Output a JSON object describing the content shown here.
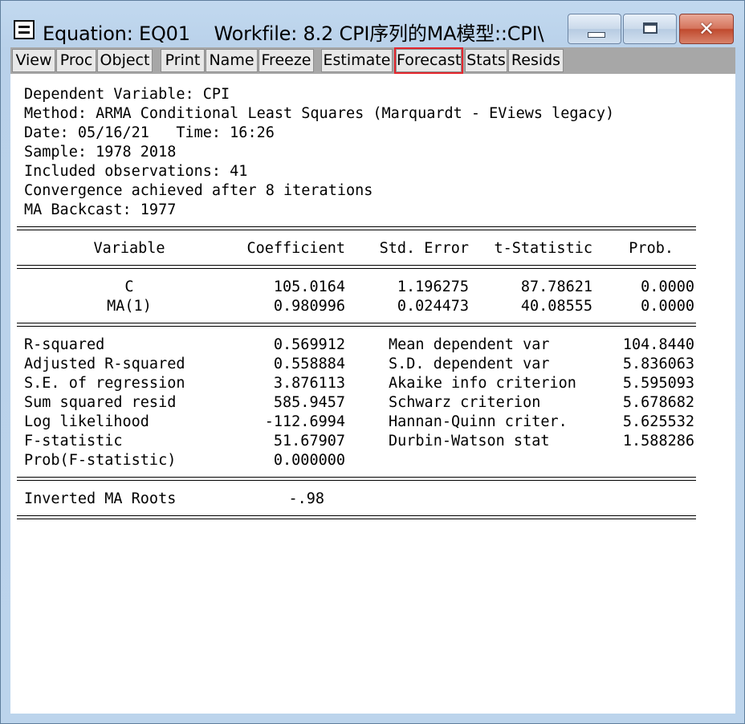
{
  "window": {
    "title": "Equation: EQ01    Workfile: 8.2 CPI序列的MA模型::CPI\\",
    "close_label": "✕"
  },
  "toolbar": {
    "buttons": [
      "View",
      "Proc",
      "Object",
      "Print",
      "Name",
      "Freeze",
      "Estimate",
      "Forecast",
      "Stats",
      "Resids"
    ],
    "highlighted": "Forecast",
    "highlight_color": "#e4262d"
  },
  "header": {
    "dependent": "Dependent Variable: CPI",
    "method": "Method: ARMA Conditional Least Squares (Marquardt - EViews legacy)",
    "date": "Date: 05/16/21   Time: 16:26",
    "sample": "Sample: 1978 2018",
    "observations": "Included observations: 41",
    "convergence": "Convergence achieved after 8 iterations",
    "backcast": "MA Backcast: 1977"
  },
  "coef_table": {
    "headers": [
      "Variable",
      "Coefficient",
      "Std. Error",
      "t-Statistic",
      "Prob."
    ],
    "rows": [
      [
        "C",
        "105.0164",
        "1.196275",
        "87.78621",
        "0.0000"
      ],
      [
        "MA(1)",
        "0.980996",
        "0.024473",
        "40.08555",
        "0.0000"
      ]
    ]
  },
  "stats": {
    "left": [
      [
        "R-squared",
        "0.569912"
      ],
      [
        "Adjusted R-squared",
        "0.558884"
      ],
      [
        "S.E. of regression",
        "3.876113"
      ],
      [
        "Sum squared resid",
        "585.9457"
      ],
      [
        "Log likelihood",
        "-112.6994"
      ],
      [
        "F-statistic",
        "51.67907"
      ],
      [
        "Prob(F-statistic)",
        "0.000000"
      ]
    ],
    "right": [
      [
        "Mean dependent var",
        "104.8440"
      ],
      [
        "S.D. dependent var",
        "5.836063"
      ],
      [
        "Akaike info criterion",
        "5.595093"
      ],
      [
        "Schwarz criterion",
        "5.678682"
      ],
      [
        "Hannan-Quinn criter.",
        "5.625532"
      ],
      [
        "Durbin-Watson stat",
        "1.588286"
      ]
    ]
  },
  "roots": {
    "label": "Inverted MA Roots",
    "value": "-.98"
  }
}
